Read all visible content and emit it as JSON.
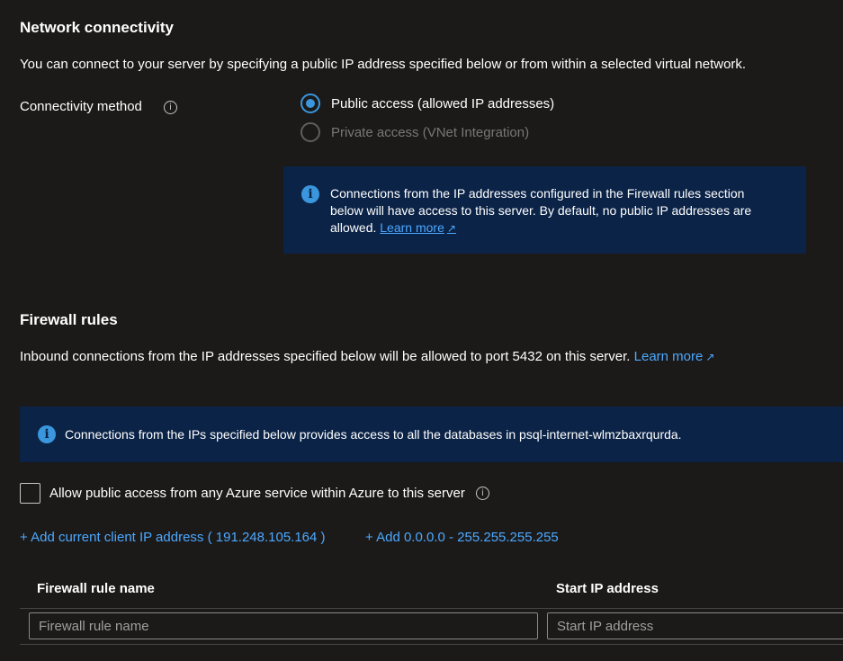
{
  "network": {
    "title": "Network connectivity",
    "description": "You can connect to your server by specifying a public IP address specified below or from within a selected virtual network.",
    "connectivity_label": "Connectivity method",
    "options": [
      {
        "label": "Public access (allowed IP addresses)",
        "selected": true,
        "disabled": false
      },
      {
        "label": "Private access (VNet Integration)",
        "selected": false,
        "disabled": true
      }
    ],
    "info_text": "Connections from the IP addresses configured in the Firewall rules section below will have access to this server. By default, no public IP addresses are allowed.",
    "learn_more": "Learn more"
  },
  "firewall": {
    "title": "Firewall rules",
    "description": "Inbound connections from the IP addresses specified below will be allowed to port 5432 on this server.",
    "learn_more": "Learn more",
    "info_text": "Connections from the IPs specified below provides access to all the databases in psql-internet-wlmzbaxrqurda.",
    "allow_azure_label": "Allow public access from any Azure service within Azure to this server",
    "allow_azure_checked": false,
    "add_client_ip": "+ Add current client IP address ( 191.248.105.164 )",
    "add_all_range": "+ Add 0.0.0.0 - 255.255.255.255",
    "table": {
      "columns": [
        "Firewall rule name",
        "Start IP address"
      ],
      "row": {
        "name_placeholder": "Firewall rule name",
        "start_ip_placeholder": "Start IP address",
        "name_value": "",
        "start_ip_value": ""
      }
    }
  },
  "icons": {
    "info": "info-circle-icon",
    "external_link": "external-link-icon"
  },
  "colors": {
    "accent": "#3a96dd",
    "link": "#4ca8ff",
    "info_box_bg": "#0b2347",
    "page_bg": "#1b1a19"
  }
}
